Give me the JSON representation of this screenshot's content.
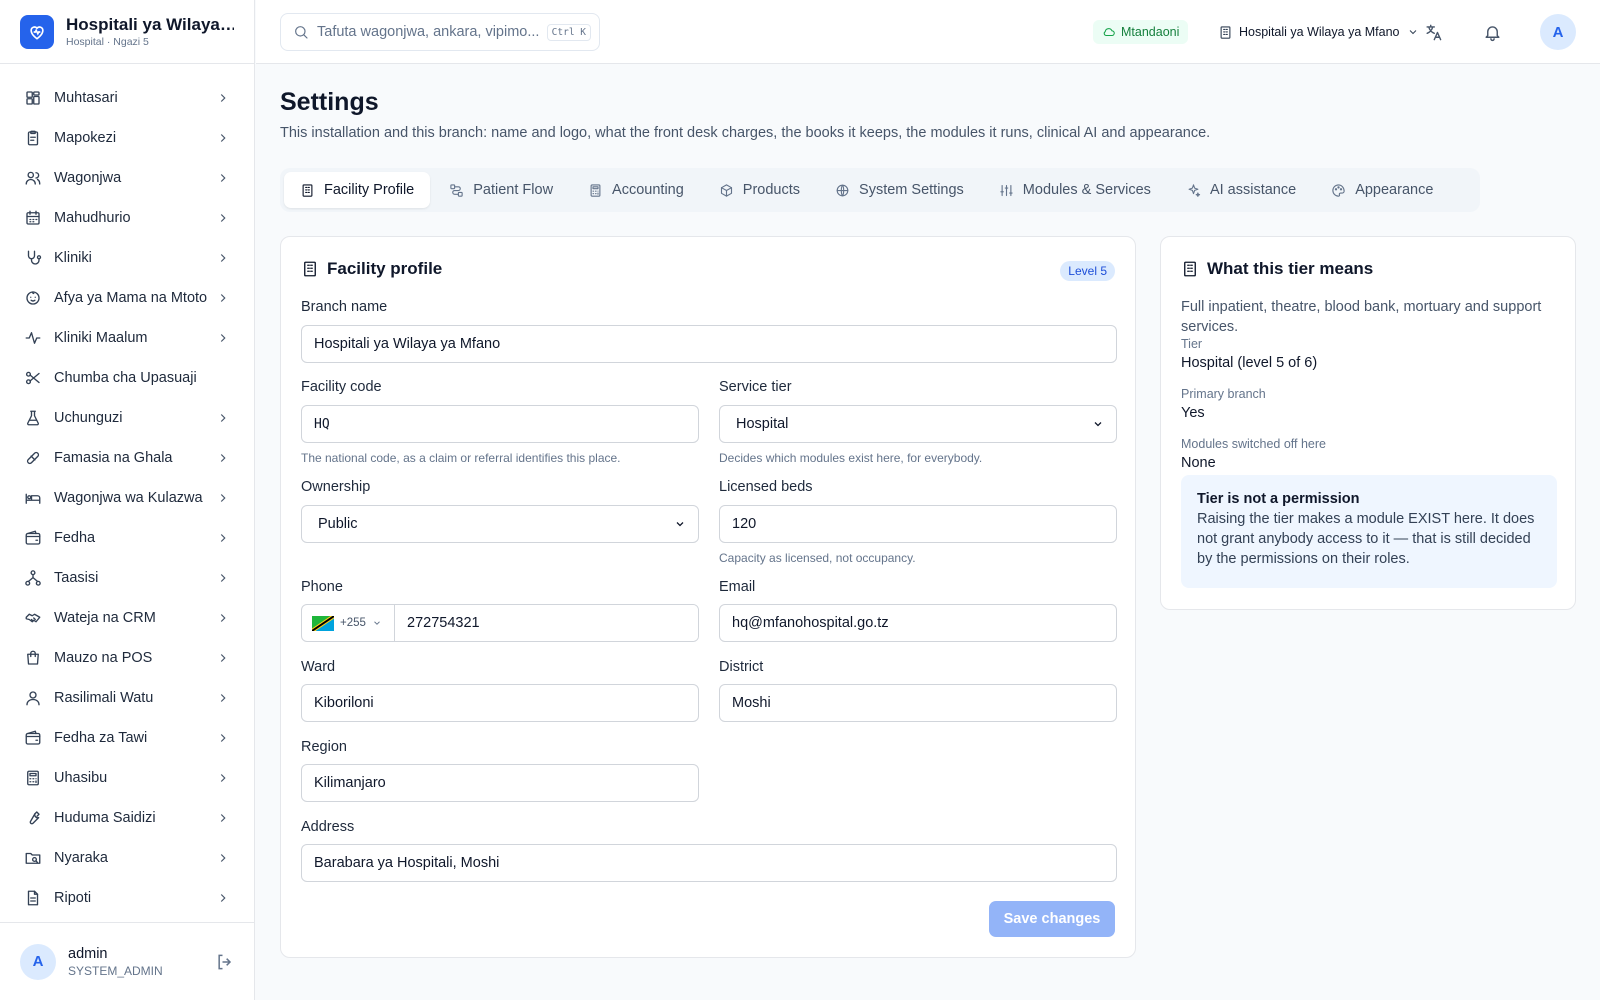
{
  "brand": {
    "name": "Hospitali ya Wilaya ya Mfano",
    "subtitle": "Hospital · Ngazi 5"
  },
  "sidebar": {
    "items": [
      {
        "label": "Muhtasari",
        "icon": "dashboard-icon",
        "chevron": true
      },
      {
        "label": "Mapokezi",
        "icon": "clipboard-icon",
        "chevron": true
      },
      {
        "label": "Wagonjwa",
        "icon": "users-icon",
        "chevron": true
      },
      {
        "label": "Mahudhurio",
        "icon": "calendar-icon",
        "chevron": true
      },
      {
        "label": "Kliniki",
        "icon": "stethoscope-icon",
        "chevron": true
      },
      {
        "label": "Afya ya Mama na Mtoto",
        "icon": "baby-icon",
        "chevron": true
      },
      {
        "label": "Kliniki Maalum",
        "icon": "activity-icon",
        "chevron": true
      },
      {
        "label": "Chumba cha Upasuaji",
        "icon": "scissors-icon",
        "chevron": false
      },
      {
        "label": "Uchunguzi",
        "icon": "flask-icon",
        "chevron": true
      },
      {
        "label": "Famasia na Ghala",
        "icon": "pill-icon",
        "chevron": true
      },
      {
        "label": "Wagonjwa wa Kulazwa",
        "icon": "bed-icon",
        "chevron": true
      },
      {
        "label": "Fedha",
        "icon": "wallet-icon",
        "chevron": true
      },
      {
        "label": "Taasisi",
        "icon": "network-icon",
        "chevron": true
      },
      {
        "label": "Wateja na CRM",
        "icon": "handshake-icon",
        "chevron": true
      },
      {
        "label": "Mauzo na POS",
        "icon": "shopping-bag-icon",
        "chevron": true
      },
      {
        "label": "Rasilimali Watu",
        "icon": "user-icon",
        "chevron": true
      },
      {
        "label": "Fedha za Tawi",
        "icon": "wallet-icon",
        "chevron": true
      },
      {
        "label": "Uhasibu",
        "icon": "calculator-icon",
        "chevron": true
      },
      {
        "label": "Huduma Saidizi",
        "icon": "wrench-icon",
        "chevron": true
      },
      {
        "label": "Nyaraka",
        "icon": "folder-search-icon",
        "chevron": true
      },
      {
        "label": "Ripoti",
        "icon": "document-icon",
        "chevron": true
      }
    ],
    "user": {
      "initial": "A",
      "name": "admin",
      "role": "SYSTEM_ADMIN"
    }
  },
  "header": {
    "search_placeholder": "Tafuta wagonjwa, ankara, vipimo...",
    "search_shortcut": "Ctrl K",
    "status": "Mtandaoni",
    "branch": "Hospitali ya Wilaya ya Mfano",
    "avatar_initial": "A"
  },
  "page": {
    "title": "Settings",
    "description": "This installation and this branch: name and logo, what the front desk charges, the books it keeps, the modules it runs, clinical AI and appearance."
  },
  "tabs": [
    {
      "label": "Facility Profile",
      "icon": "building-icon",
      "active": true
    },
    {
      "label": "Patient Flow",
      "icon": "workflow-icon",
      "active": false
    },
    {
      "label": "Accounting",
      "icon": "calculator-icon",
      "active": false
    },
    {
      "label": "Products",
      "icon": "package-icon",
      "active": false
    },
    {
      "label": "System Settings",
      "icon": "globe-icon",
      "active": false
    },
    {
      "label": "Modules & Services",
      "icon": "sliders-icon",
      "active": false
    },
    {
      "label": "AI assistance",
      "icon": "sparkles-icon",
      "active": false
    },
    {
      "label": "Appearance",
      "icon": "palette-icon",
      "active": false
    }
  ],
  "profile": {
    "title": "Facility profile",
    "badge": "Level 5",
    "branch_name": {
      "label": "Branch name",
      "value": "Hospitali ya Wilaya ya Mfano"
    },
    "facility_code": {
      "label": "Facility code",
      "value": "HQ",
      "hint": "The national code, as a claim or referral identifies this place."
    },
    "service_tier": {
      "label": "Service tier",
      "value": "Hospital",
      "hint": "Decides which modules exist here, for everybody."
    },
    "ownership": {
      "label": "Ownership",
      "value": "Public"
    },
    "licensed_beds": {
      "label": "Licensed beds",
      "value": "120",
      "hint": "Capacity as licensed, not occupancy."
    },
    "phone": {
      "label": "Phone",
      "country_code": "+255",
      "value": "272754321"
    },
    "email": {
      "label": "Email",
      "value": "hq@mfanohospital.go.tz"
    },
    "ward": {
      "label": "Ward",
      "value": "Kiboriloni"
    },
    "district": {
      "label": "District",
      "value": "Moshi"
    },
    "region": {
      "label": "Region",
      "value": "Kilimanjaro"
    },
    "address": {
      "label": "Address",
      "value": "Barabara ya Hospitali, Moshi"
    },
    "save_label": "Save changes"
  },
  "tier_info": {
    "title": "What this tier means",
    "description": "Full inpatient, theatre, blood bank, mortuary and support services.",
    "tier_label": "Tier",
    "tier_value": "Hospital (level 5 of 6)",
    "primary_label": "Primary branch",
    "primary_value": "Yes",
    "modules_off_label": "Modules switched off here",
    "modules_off_value": "None",
    "note_title": "Tier is not a permission",
    "note_body": "Raising the tier makes a module EXIST here. It does not grant anybody access to it — that is still decided by the permissions on their roles."
  },
  "colors": {
    "accent": "#2563eb",
    "online": "#15803d",
    "badge_bg": "#dbeafe",
    "save_disabled": "#93b4f8"
  }
}
